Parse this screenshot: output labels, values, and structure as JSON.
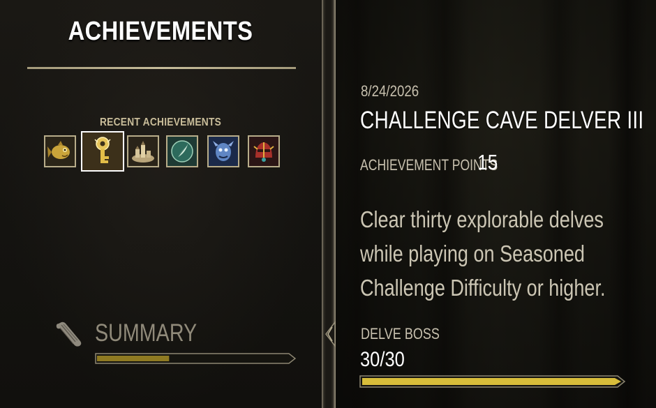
{
  "left_panel": {
    "title": "ACHIEVEMENTS",
    "recent_label": "RECENT ACHIEVEMENTS",
    "recent_badges": [
      {
        "icon": "golden-fish-icon",
        "selected": false
      },
      {
        "icon": "golden-key-icon",
        "selected": true
      },
      {
        "icon": "town-icon",
        "selected": false
      },
      {
        "icon": "quill-emblem-icon",
        "selected": false
      },
      {
        "icon": "blue-creature-icon",
        "selected": false
      },
      {
        "icon": "red-helm-icon",
        "selected": false
      }
    ],
    "summary": {
      "label": "SUMMARY",
      "icon": "scroll-icon",
      "progress_fraction": 0.38
    }
  },
  "right_panel": {
    "date": "8/24/2026",
    "name": "CHALLENGE CAVE DELVER III",
    "points_label": "ACHIEVEMENT POINTS",
    "points_value": "15",
    "description_lines": [
      "Clear thirty explorable delves",
      "while playing on Seasoned",
      "Challenge Difficulty or higher."
    ],
    "criteria": {
      "label": "DELVE BOSS",
      "count": "30/30",
      "progress_fraction": 1.0
    }
  },
  "colors": {
    "gold_fill": "#d8bd3a",
    "gold_dark": "#8f7a22",
    "frame": "#b8ad8a"
  }
}
